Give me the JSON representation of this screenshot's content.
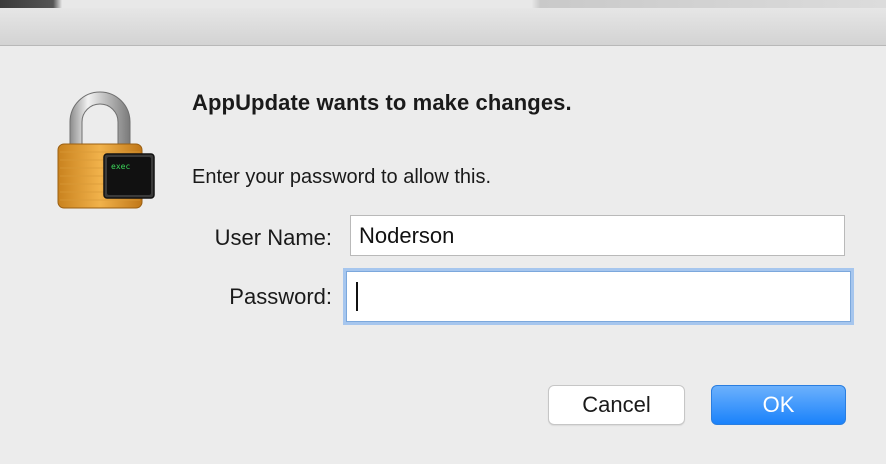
{
  "dialog": {
    "heading": "AppUpdate wants to make changes.",
    "subtext": "Enter your password to allow this.",
    "icon": "lock-exec-icon",
    "icon_text": "exec"
  },
  "form": {
    "username_label": "User Name:",
    "username_value": "Noderson",
    "password_label": "Password:",
    "password_value": ""
  },
  "buttons": {
    "cancel_label": "Cancel",
    "ok_label": "OK"
  },
  "colors": {
    "accent": "#1a82fb",
    "focus_ring": "#a6c6ee",
    "background": "#ececec"
  }
}
